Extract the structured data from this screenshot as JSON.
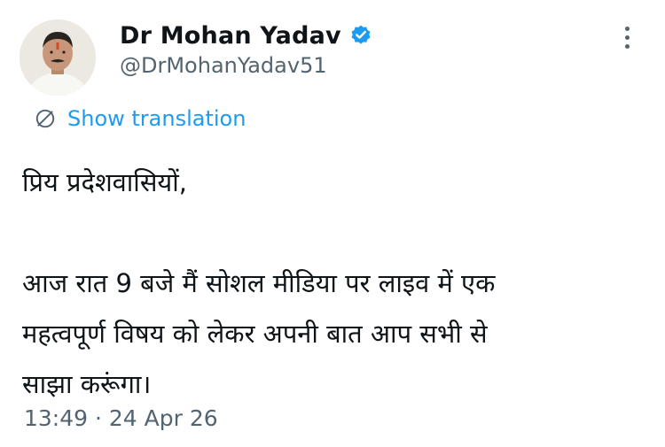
{
  "author": {
    "display_name": "Dr Mohan Yadav",
    "handle": "@DrMohanYadav51",
    "verified": true,
    "verified_color": "#1d9bf0"
  },
  "translate": {
    "label": "Show translation",
    "icon": "globe-slash-icon",
    "color": "#1d9bf0"
  },
  "tweet": {
    "text": "प्रिय प्रदेशवासियों,\n\nआज रात 9 बजे मैं सोशल मीडिया पर लाइव में एक\nमहत्वपूर्ण विषय को लेकर अपनी बात आप सभी से\nसाझा करूंगा।",
    "timestamp": "13:49 · 24 Apr 26"
  },
  "icons": {
    "more": "more-vertical-icon",
    "verified": "verified-badge-icon"
  }
}
